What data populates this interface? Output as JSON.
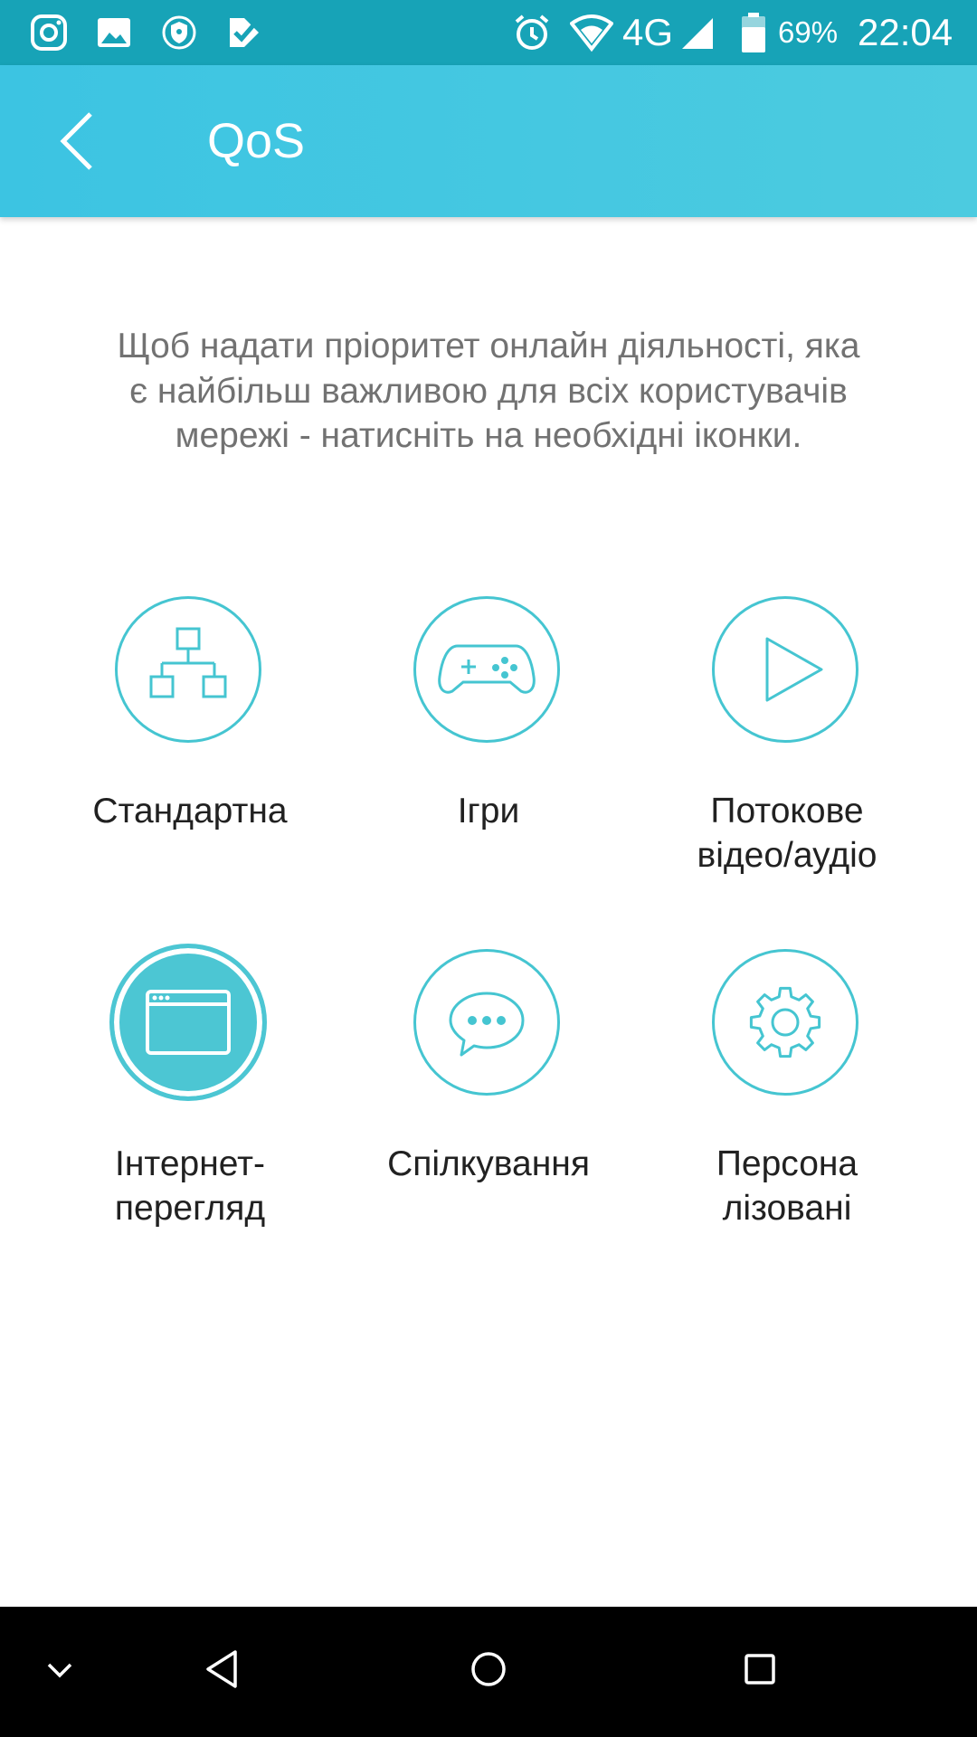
{
  "status_bar": {
    "notification_icons": [
      "instagram-icon",
      "gallery-icon",
      "vpn-shield-icon",
      "check-app-icon"
    ],
    "network": "4G",
    "battery": "69%",
    "time": "22:04"
  },
  "app_bar": {
    "title": "QoS"
  },
  "description": "Щоб надати пріоритет онлайн діяльності, яка є найбільш важливою для всіх користувачів мережі - натисніть на необхідні іконки.",
  "modes": [
    {
      "label": "Стандартна",
      "icon": "network-standard-icon",
      "selected": false
    },
    {
      "label": "Ігри",
      "icon": "gamepad-icon",
      "selected": false
    },
    {
      "label": "Потокове\nвідео/аудіо",
      "icon": "play-icon",
      "selected": false
    },
    {
      "label": "Інтернет-\nперегляд",
      "icon": "browser-window-icon",
      "selected": true
    },
    {
      "label": "Спілкування",
      "icon": "chat-bubble-icon",
      "selected": false
    },
    {
      "label": "Персона\nлізовані",
      "icon": "gear-icon",
      "selected": false
    }
  ],
  "colors": {
    "status_bar": "#17a3b7",
    "app_bar": "#3cc4e2",
    "accent": "#45c5d1",
    "description_text": "#727272",
    "label_text": "#212121"
  }
}
